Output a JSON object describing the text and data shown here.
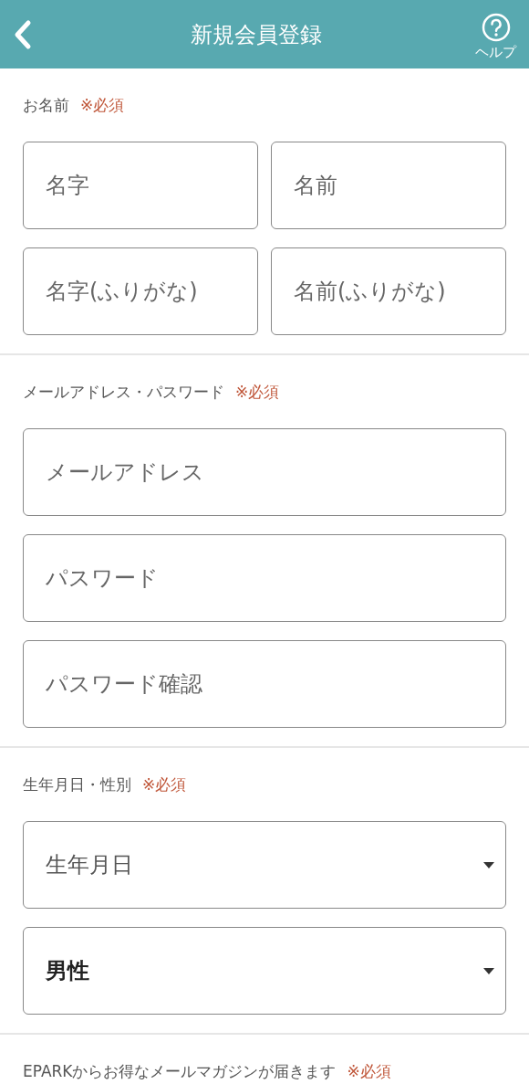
{
  "header": {
    "title": "新規会員登録",
    "help_label": "ヘルプ"
  },
  "sections": [
    {
      "label": "お名前",
      "required": "※必須",
      "fields": [
        {
          "kind": "text",
          "placeholder": "名字",
          "half": true
        },
        {
          "kind": "text",
          "placeholder": "名前",
          "half": true
        },
        {
          "kind": "text",
          "placeholder": "名字(ふりがな)",
          "half": true
        },
        {
          "kind": "text",
          "placeholder": "名前(ふりがな)",
          "half": true
        }
      ]
    },
    {
      "label": "メールアドレス・パスワード",
      "required": "※必須",
      "fields": [
        {
          "kind": "text",
          "placeholder": "メールアドレス",
          "half": false
        },
        {
          "kind": "text",
          "placeholder": "パスワード",
          "half": false
        },
        {
          "kind": "text",
          "placeholder": "パスワード確認",
          "half": false
        }
      ]
    },
    {
      "label": "生年月日・性別",
      "required": "※必須",
      "fields": [
        {
          "kind": "select",
          "placeholder": "生年月日",
          "half": false
        },
        {
          "kind": "select",
          "value": "男性",
          "half": false
        }
      ]
    },
    {
      "label": "EPARKからお得なメールマガジンが届きます",
      "required": "※必須"
    }
  ]
}
